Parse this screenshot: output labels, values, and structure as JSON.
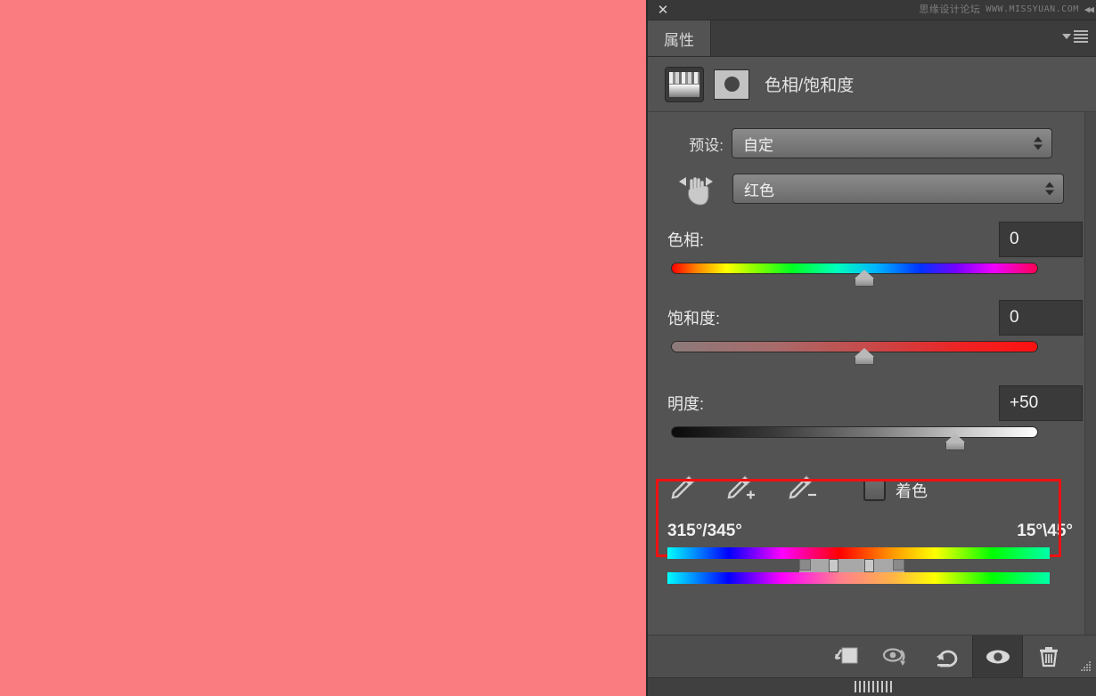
{
  "window": {
    "close_label": "✕",
    "watermark_cn": "思缘设计论坛",
    "watermark_url": "WWW.MISSYUAN.COM",
    "collapse_arrows": "◀◀"
  },
  "panel": {
    "tab_label": "属性",
    "title": "色相/饱和度",
    "thumb_adjustment_name": "hue-saturation-thumbnail",
    "thumb_mask_name": "layer-mask-thumbnail"
  },
  "preset": {
    "label": "预设:",
    "value": "自定"
  },
  "color_range": {
    "value": "红色",
    "tool_name": "on-image-adjustment-hand"
  },
  "sliders": [
    {
      "id": "hue",
      "label": "色相:",
      "value": "0",
      "thumb_percent": 50
    },
    {
      "id": "saturation",
      "label": "饱和度:",
      "value": "0",
      "thumb_percent": 50
    },
    {
      "id": "lightness",
      "label": "明度:",
      "value": "+50",
      "thumb_percent": 75
    }
  ],
  "tools": {
    "eyedropper": "eyedropper-icon",
    "eyedropper_add": "eyedropper-add-icon",
    "eyedropper_subtract": "eyedropper-subtract-icon",
    "colorize_label": "着色",
    "colorize_checked": false
  },
  "hue_range": {
    "left_degrees": "315°/345°",
    "right_degrees": "15°\\45°"
  },
  "bottom_bar": {
    "buttons": [
      {
        "name": "clip-to-layer-button",
        "icon": "clip-to-layer-icon",
        "active": false
      },
      {
        "name": "toggle-previous-state-button",
        "icon": "eye-cycle-icon",
        "active": false
      },
      {
        "name": "reset-button",
        "icon": "reset-arrow-icon",
        "active": false
      },
      {
        "name": "toggle-visibility-button",
        "icon": "eye-icon",
        "active": true
      },
      {
        "name": "delete-layer-button",
        "icon": "trash-icon",
        "active": false
      }
    ]
  },
  "colors": {
    "canvas": "#fa7b80",
    "panel_bg": "#535353",
    "highlight": "#ee1111",
    "text": "#eaeaea"
  }
}
